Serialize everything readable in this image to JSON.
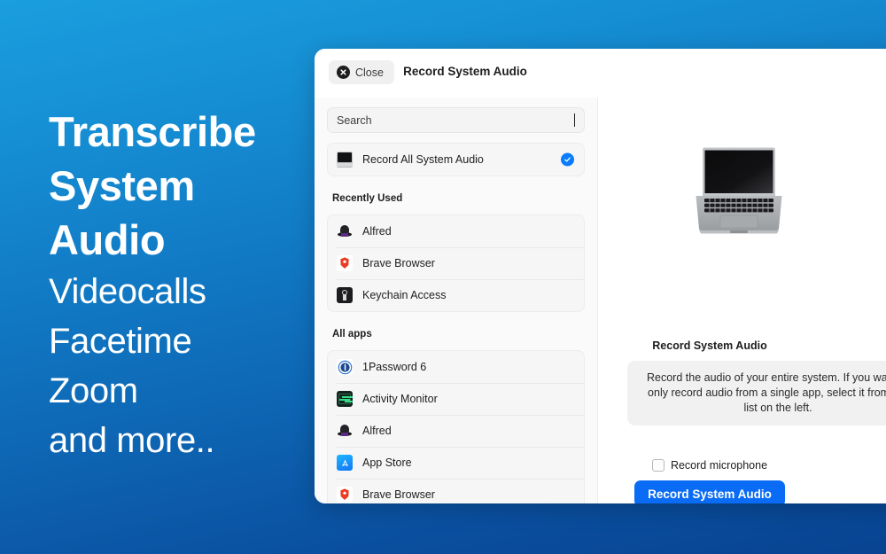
{
  "promo": {
    "lines": [
      {
        "text": "Transcribe",
        "weight": "bold"
      },
      {
        "text": "System",
        "weight": "bold"
      },
      {
        "text": "Audio",
        "weight": "bold"
      },
      {
        "text": "Videocalls",
        "weight": "light"
      },
      {
        "text": "Facetime",
        "weight": "light"
      },
      {
        "text": "Zoom",
        "weight": "light"
      },
      {
        "text": "and more..",
        "weight": "light"
      }
    ]
  },
  "window": {
    "title": "Record System Audio",
    "close_label": "Close"
  },
  "search": {
    "placeholder": "Search",
    "value": ""
  },
  "system_audio_row": {
    "label": "Record All System Audio",
    "icon": "laptop-icon",
    "selected": true
  },
  "sections": [
    {
      "label": "Recently Used",
      "items": [
        {
          "label": "Alfred",
          "icon": "alfred-icon"
        },
        {
          "label": "Brave Browser",
          "icon": "brave-icon"
        },
        {
          "label": "Keychain Access",
          "icon": "keychain-icon"
        }
      ]
    },
    {
      "label": "All apps",
      "items": [
        {
          "label": "1Password 6",
          "icon": "onepassword-icon"
        },
        {
          "label": "Activity Monitor",
          "icon": "activity-monitor-icon"
        },
        {
          "label": "Alfred",
          "icon": "alfred-icon"
        },
        {
          "label": "App Store",
          "icon": "app-store-icon"
        },
        {
          "label": "Brave Browser",
          "icon": "brave-icon"
        }
      ]
    }
  ],
  "detail": {
    "illustration": "macbook-illustration",
    "title": "Record System Audio",
    "description": "Record the audio of your entire system. If you want to only record audio from a single app, select it from the list on the left.",
    "microphone_label": "Record microphone",
    "microphone_checked": false,
    "record_button_label": "Record System Audio"
  },
  "colors": {
    "accent": "#0a6cf5",
    "check_badge": "#0a7cff",
    "bg_gradient_top": "#1a9ede",
    "bg_gradient_bottom": "#084391"
  }
}
